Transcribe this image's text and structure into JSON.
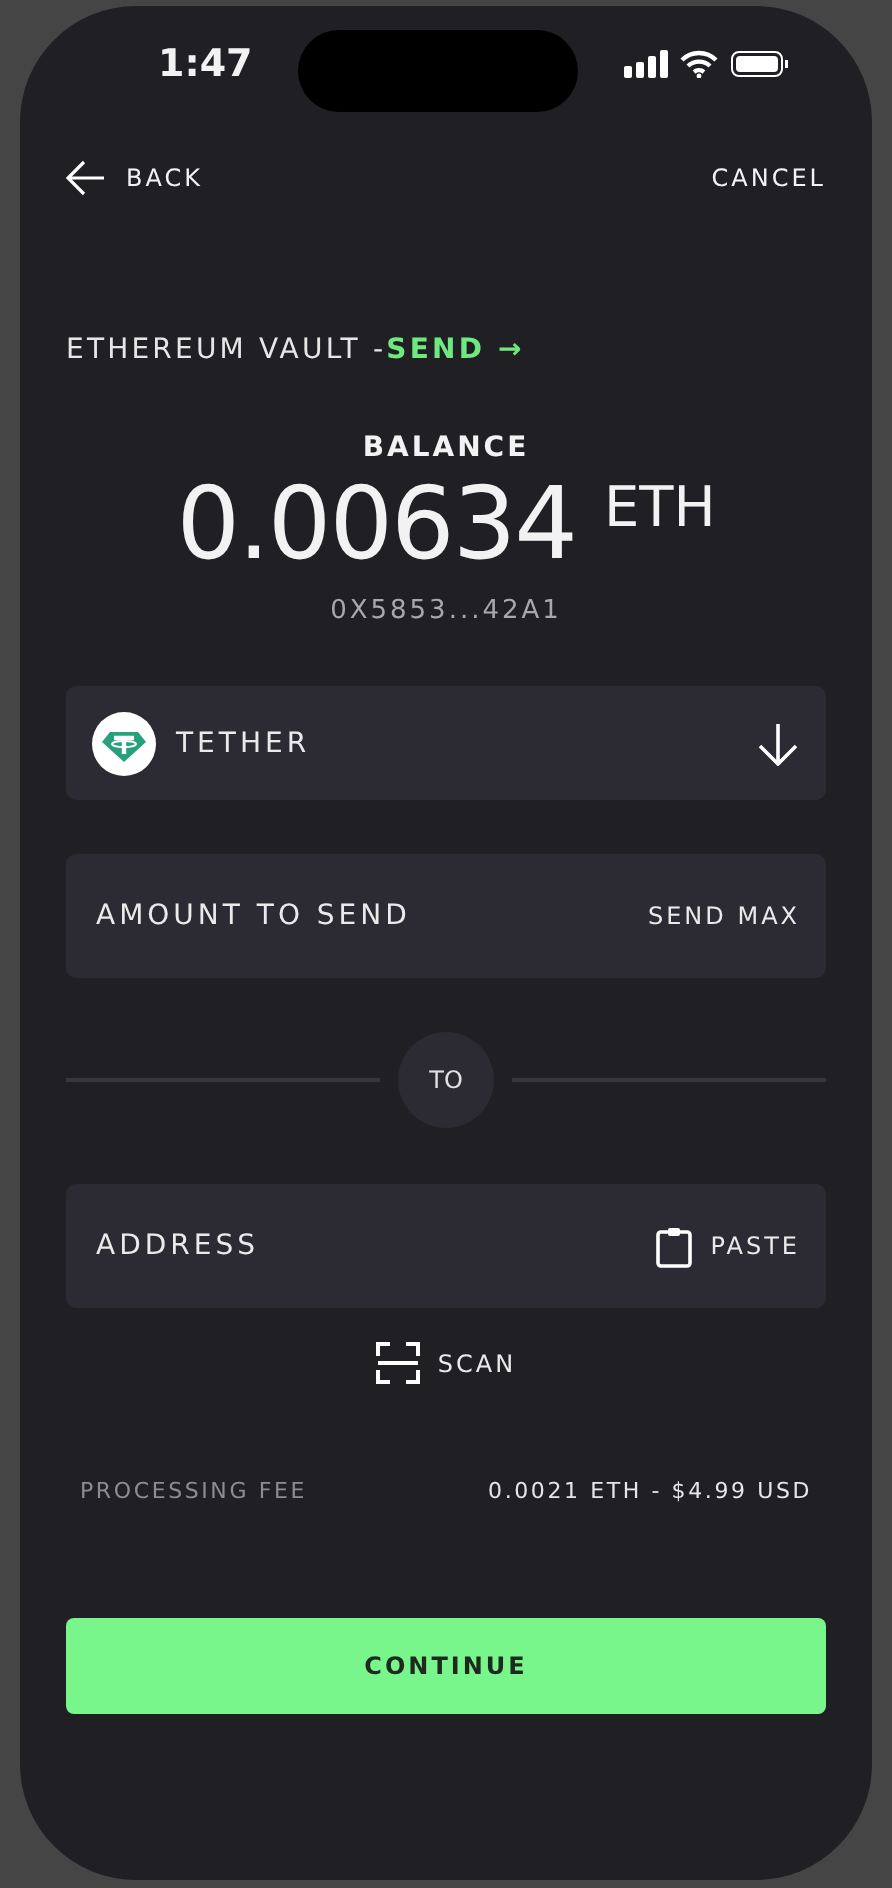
{
  "status_bar": {
    "time": "1:47"
  },
  "nav": {
    "back": "BACK",
    "cancel": "CANCEL"
  },
  "title": {
    "prefix": "ETHEREUM VAULT - ",
    "action": "SEND →"
  },
  "balance": {
    "label": "BALANCE",
    "amount": "0.00634",
    "unit": "ETH",
    "address": "0X5853...42A1"
  },
  "token": {
    "name": "TETHER"
  },
  "amount": {
    "placeholder": "AMOUNT TO SEND",
    "max": "SEND MAX"
  },
  "divider": {
    "label": "TO"
  },
  "recipient": {
    "placeholder": "ADDRESS",
    "paste": "PASTE"
  },
  "scan": {
    "label": "SCAN"
  },
  "fee": {
    "label": "PROCESSING FEE",
    "value": "0.0021 ETH - $4.99 USD"
  },
  "continue": {
    "label": "CONTINUE"
  }
}
